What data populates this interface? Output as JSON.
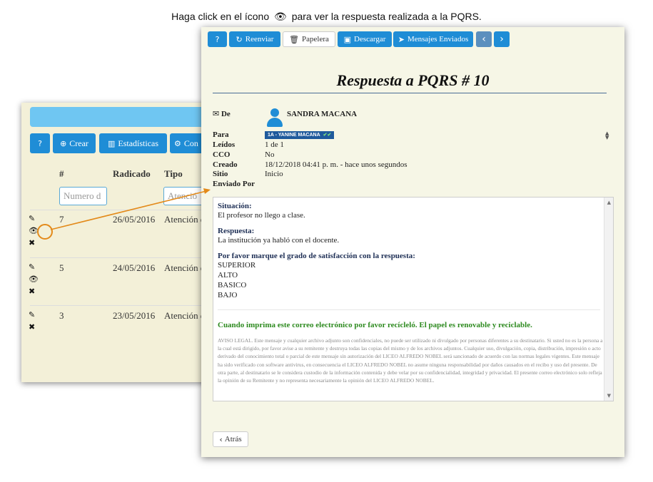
{
  "caption": {
    "before": "Haga click en el ícono",
    "eye": "👁",
    "after": "para ver la respuesta realizada a la PQRS."
  },
  "background_window": {
    "toolbar": [
      {
        "icon": "?",
        "label": ""
      },
      {
        "icon": "⊕",
        "label": "Crear"
      },
      {
        "icon": "▥",
        "label": "Estadísticas"
      },
      {
        "icon": "⚙",
        "label": "Con"
      }
    ],
    "columns": [
      "#",
      "Radicado",
      "Tipo"
    ],
    "filters": {
      "numero_placeholder": "Numero d",
      "tipo_placeholder": "Atenció"
    },
    "rows": [
      {
        "num": "7",
        "date": "26/05/2016",
        "tipo": "Atención d"
      },
      {
        "num": "5",
        "date": "24/05/2016",
        "tipo": "Atención d"
      },
      {
        "num": "3",
        "date": "23/05/2016",
        "tipo": "Atención d"
      }
    ],
    "row_icons": {
      "edit": "✎",
      "view": "👁",
      "delete": "✖"
    }
  },
  "foreground_window": {
    "toolbar": {
      "help": "?",
      "reenviar": "Reenviar",
      "papelera": "Papelera",
      "descargar": "Descargar",
      "mensajes": "Mensajes Enviados",
      "prev": "‹",
      "next": "›"
    },
    "title": "Respuesta a PQRS # 10",
    "fields": {
      "de_label": "De",
      "de_value": "SANDRA MACANA",
      "para_label": "Para",
      "para_tag": "1A - YANINE MACANA",
      "leidos_label": "Leídos",
      "leidos_value": "1 de 1",
      "cco_label": "CCO",
      "cco_value": "No",
      "creado_label": "Creado",
      "creado_value": "18/12/2018  04:41 p. m.  -  hace unos segundos",
      "sitio_label": "Sitio",
      "sitio_value": "Inicio",
      "enviado_label": "Enviado Por"
    },
    "body": {
      "situacion_label": "Situación:",
      "situacion_text": "El profesor no llego a clase.",
      "respuesta_label": "Respuesta:",
      "respuesta_text": "La institución ya habló con el docente.",
      "satisfaccion_label": "Por favor marque el grado de satisfacción con la respuesta:",
      "options": [
        "SUPERIOR",
        "ALTO",
        "BASICO",
        "BAJO"
      ],
      "green_note": "Cuando imprima este correo electrónico por favor recícleló. El papel es renovable y reciclable.",
      "legal": "AVISO LEGAL. Este mensaje y cualquier archivo adjunto son confidenciales, no puede ser utilizado ni divulgado por personas diferentes a su destinatario. Si usted no es la persona a la cual está dirigido, por favor avise a su remitente y destruya todas las copias del mismo y de los archivos adjuntos. Cualquier uso, divulgación, copia, distribución, impresión o acto derivado del conocimiento total o parcial de este mensaje sin autorización del LICEO ALFREDO NOBEL será sancionado de acuerdo con las normas legales vigentes. Este mensaje ha sido verificado con software antivirus, en consecuencia el LICEO ALFREDO NOBEL no asume ninguna responsabilidad por daños causados en el recibo y uso del presente. De otra parte, al destinatario se le considera custodio de la información contenida y debe velar por su confidencialidad, integridad y privacidad. El presente correo electrónico solo refleja la opinión de su Remitente y no representa necesariamente la opinión del LICEO ALFREDO NOBEL."
    },
    "back_label": "Atrás"
  },
  "colors": {
    "primary": "#1f8dd6",
    "accent_arrow": "#e38a1a",
    "green_note": "#2d8a1f",
    "title_rule": "#4a6d95"
  }
}
